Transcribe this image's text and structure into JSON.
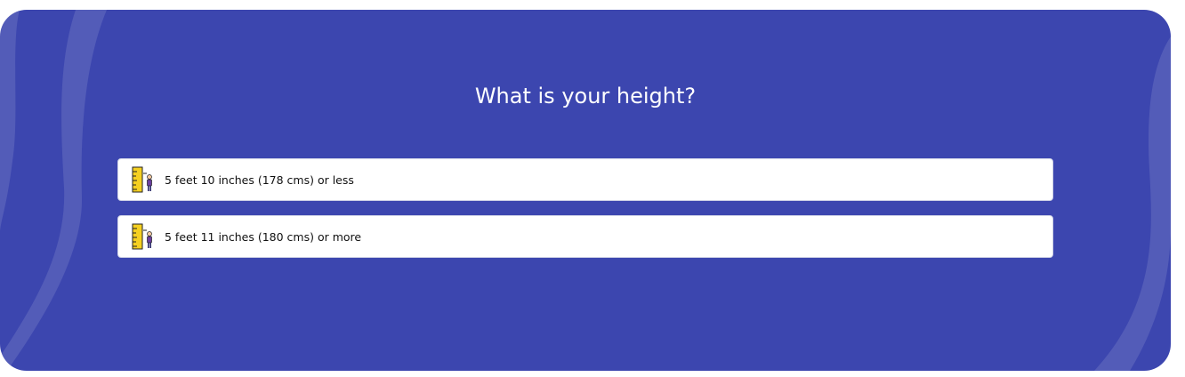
{
  "question": {
    "title": "What is your height?"
  },
  "options": [
    {
      "label": "5 feet 10 inches (178 cms) or less",
      "icon": "ruler-person-icon"
    },
    {
      "label": "5 feet 11 inches (180 cms) or more",
      "icon": "ruler-person-icon"
    }
  ],
  "colors": {
    "background": "#3c46af",
    "option_background": "#ffffff",
    "title_text": "#ffffff",
    "ruler": "#f5d020",
    "person": "#6b3fa0"
  }
}
